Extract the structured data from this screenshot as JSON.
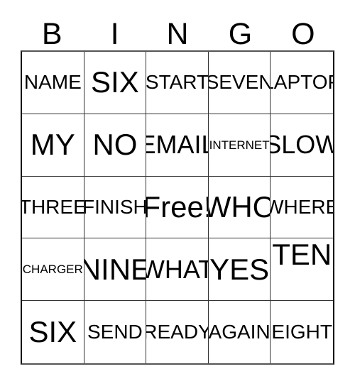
{
  "card": {
    "type": "bingo-card",
    "grid_size": "5x5",
    "header_letters": [
      "B",
      "I",
      "N",
      "G",
      "O"
    ],
    "colors": {
      "background": "#ffffff",
      "text": "#000000",
      "grid_line": "#333333",
      "outer_border": "#111111"
    },
    "rows": [
      [
        {
          "text": "NAME",
          "size": "lg",
          "valign": "center"
        },
        {
          "text": "SIX",
          "size": "xxl",
          "valign": "center"
        },
        {
          "text": "START",
          "size": "lg",
          "valign": "center"
        },
        {
          "text": "SEVEN",
          "size": "lg",
          "valign": "center"
        },
        {
          "text": "LAPTOP",
          "size": "lg",
          "valign": "center"
        }
      ],
      [
        {
          "text": "MY",
          "size": "xxl",
          "valign": "center"
        },
        {
          "text": "NO",
          "size": "xxl",
          "valign": "center"
        },
        {
          "text": "EMAIL",
          "size": "xl",
          "valign": "center"
        },
        {
          "text": "INTERNET",
          "size": "sm",
          "valign": "center"
        },
        {
          "text": "SLOW",
          "size": "xl",
          "valign": "center"
        }
      ],
      [
        {
          "text": "THREE",
          "size": "lg",
          "valign": "center"
        },
        {
          "text": "FINISH",
          "size": "lg",
          "valign": "center"
        },
        {
          "text": "Free!",
          "size": "xxl",
          "valign": "center"
        },
        {
          "text": "WHO",
          "size": "xxl",
          "valign": "center"
        },
        {
          "text": "WHERE",
          "size": "lg",
          "valign": "center"
        }
      ],
      [
        {
          "text": "CHARGER",
          "size": "sm",
          "valign": "center"
        },
        {
          "text": "NINE",
          "size": "xxl",
          "valign": "center"
        },
        {
          "text": "WHAT",
          "size": "xl",
          "valign": "center"
        },
        {
          "text": "YES",
          "size": "xxl",
          "valign": "center"
        },
        {
          "text": "TEN",
          "size": "xxl",
          "valign": "top"
        }
      ],
      [
        {
          "text": "SIX",
          "size": "xxl",
          "valign": "center"
        },
        {
          "text": "SEND",
          "size": "lg",
          "valign": "center"
        },
        {
          "text": "READY",
          "size": "lg",
          "valign": "center"
        },
        {
          "text": "AGAIN",
          "size": "lg",
          "valign": "center"
        },
        {
          "text": "EIGHT",
          "size": "lg",
          "valign": "center"
        }
      ]
    ],
    "free_space": {
      "row": 2,
      "col": 2,
      "label": "Free!"
    }
  }
}
